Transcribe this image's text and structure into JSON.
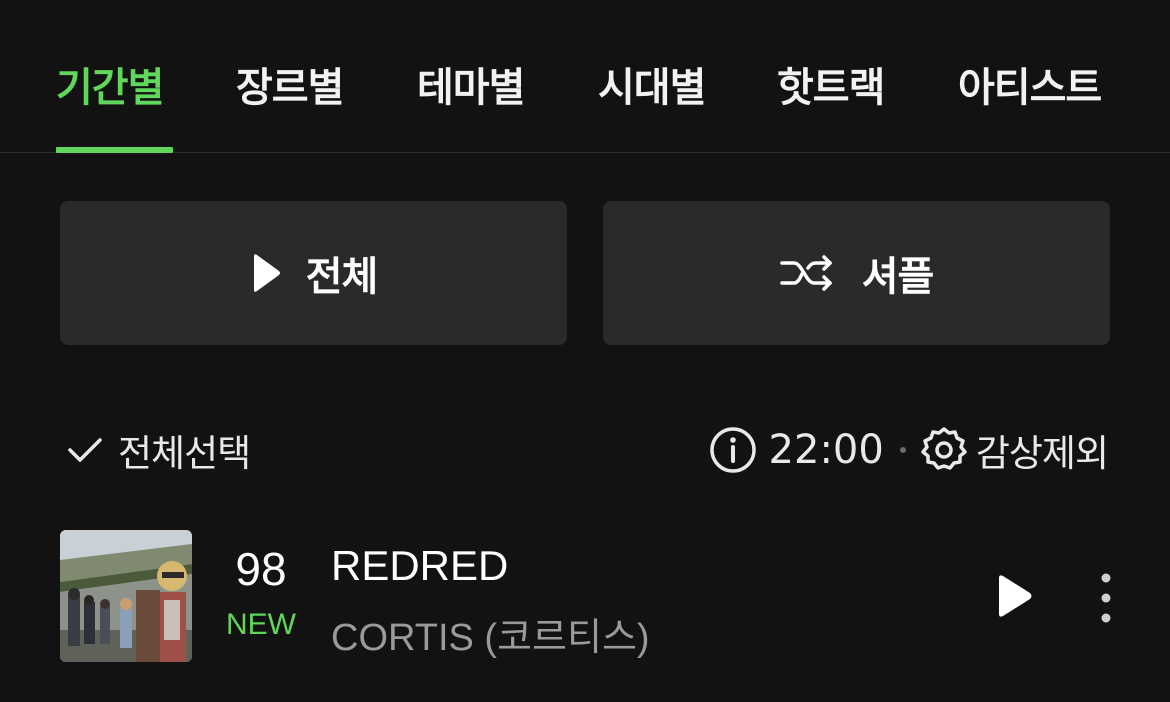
{
  "tabs": [
    {
      "label": "기간별",
      "active": true
    },
    {
      "label": "장르별",
      "active": false
    },
    {
      "label": "테마별",
      "active": false
    },
    {
      "label": "시대별",
      "active": false
    },
    {
      "label": "핫트랙",
      "active": false
    },
    {
      "label": "아티스트",
      "active": false
    }
  ],
  "actions": {
    "play_all": {
      "label": "전체",
      "icon": "play-icon"
    },
    "shuffle": {
      "label": "셔플",
      "icon": "shuffle-icon"
    }
  },
  "toolbar": {
    "select_all_label": "전체선택",
    "select_icon": "check-icon",
    "info_icon": "info-icon",
    "time": "22:00",
    "exclude_label": "감상제외",
    "exclude_icon": "gear-icon"
  },
  "track": {
    "rank": "98",
    "badge": "NEW",
    "title": "REDRED",
    "artist": "CORTIS (코르티스)",
    "play_icon": "play-icon",
    "more_icon": "more-vertical-icon"
  },
  "colors": {
    "background": "#121212",
    "accent": "#60d65a",
    "button_bg": "#2a2a2a",
    "secondary_text": "#9a9a9a"
  }
}
